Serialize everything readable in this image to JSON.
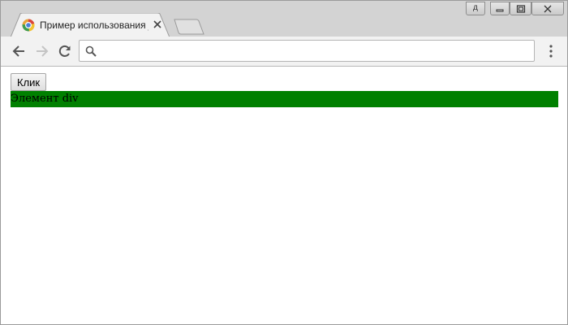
{
  "window": {
    "tab_title": "Пример использования jQuery",
    "controls": {
      "profile_label": "д"
    }
  },
  "toolbar": {
    "address_value": "",
    "address_placeholder": ""
  },
  "page": {
    "button_label": "Клик",
    "div_text": "Элемент div",
    "div_color": "#008000"
  },
  "icons": {
    "favicon": "chrome-app-icon",
    "back": "back-arrow-icon",
    "forward": "forward-arrow-icon",
    "reload": "reload-icon",
    "search": "search-icon",
    "menu": "kebab-menu-icon"
  }
}
